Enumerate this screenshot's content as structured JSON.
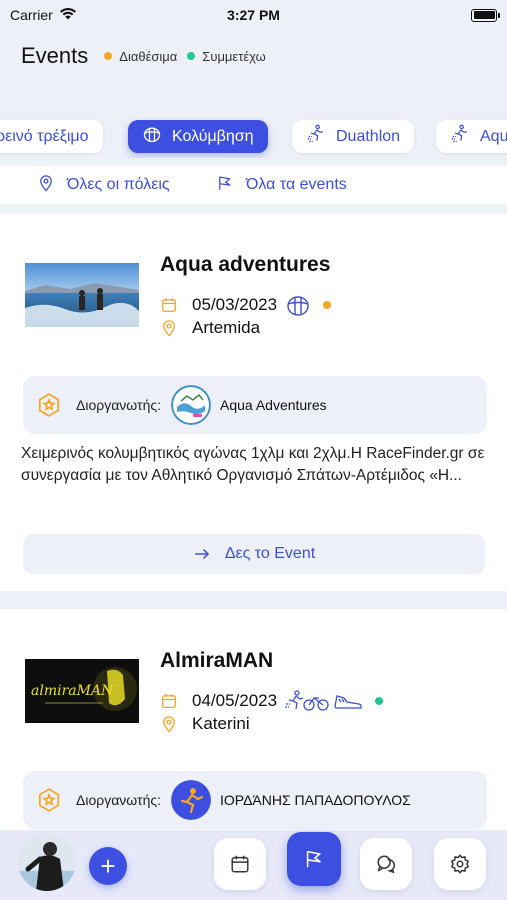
{
  "status_bar": {
    "carrier": "Carrier",
    "time": "3:27 PM"
  },
  "header": {
    "title": "Events",
    "legend": [
      {
        "label": "Διαθέσιμα",
        "color": "#f5a623"
      },
      {
        "label": "Συμμετέχω",
        "color": "#1ec98f"
      }
    ]
  },
  "categories": [
    {
      "label": "ρεινό τρέξιμο",
      "icon": "none",
      "active": false
    },
    {
      "label": "Κολύμβηση",
      "icon": "swim-icon",
      "active": true
    },
    {
      "label": "Duathlon",
      "icon": "duathlon-icon",
      "active": false
    },
    {
      "label": "Aqu",
      "icon": "aquathlon-icon",
      "active": false
    }
  ],
  "filters": {
    "cities": "Όλες οι πόλεις",
    "events": "Όλα τα events"
  },
  "events": [
    {
      "title": "Aqua adventures",
      "date": "05/03/2023",
      "location": "Artemida",
      "status_color": "#f5a623",
      "sports_icons": [
        "swim-icon"
      ],
      "organizer_label": "Διοργανωτής:",
      "organizer_name": "Aqua Adventures",
      "description": "Χειμερινός κολυμβητικός αγώνας 1χλμ και 2χλμ.Η RaceFinder.gr σε συνεργασία με τον Αθλητικό Οργανισμό Σπάτων-Αρτέμιδος «Η...",
      "cta": "Δες το Event"
    },
    {
      "title": "AlmiraMAN",
      "date": "04/05/2023",
      "location": "Katerini",
      "status_color": "#1ec98f",
      "sports_icons": [
        "triathlon-icon",
        "shoe-icon"
      ],
      "organizer_label": "Διοργανωτής:",
      "organizer_name": "ΙΟΡΔΆΝΗΣ ΠΑΠΑΔΟΠΟΥΛΟΣ",
      "thumb_text": "almiraMAN"
    }
  ],
  "bottom_nav": {
    "add_label": "+",
    "items": [
      "calendar-icon",
      "flag-icon",
      "chat-icon",
      "gear-icon"
    ],
    "active": "flag-icon"
  }
}
